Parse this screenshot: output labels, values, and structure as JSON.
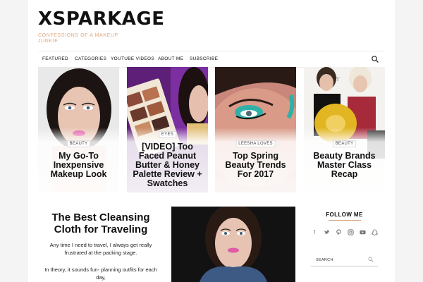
{
  "site": {
    "logo": "XSPARKAGE",
    "tagline": "CONFESSIONS OF A MAKEUP JUNKIE"
  },
  "nav": {
    "items": [
      "FEATURED",
      "CATEGORIES",
      "YOUTUBE VIDEOS",
      "ABOUT ME",
      "SUBSCRIBE"
    ],
    "search_icon": "search-icon"
  },
  "featured": [
    {
      "category": "BEAUTY",
      "title": "My Go-To Inexpensive Makeup Look"
    },
    {
      "category": "EYES",
      "title": "[VIDEO] Too Faced Peanut Butter & Honey Palette Review + Swatches"
    },
    {
      "category": "LEESHA LOVES",
      "title": "Top Spring Beauty Trends For 2017"
    },
    {
      "category": "BEAUTY",
      "title": "Beauty Brands Master Class Recap"
    }
  ],
  "post": {
    "title": "The Best Cleansing Cloth for Traveling",
    "paragraphs": [
      "Any time I need to travel, I always get really frustrated at the packing stage.",
      "In theory, it sounds fun- planning outfits for each day,"
    ]
  },
  "sidebar": {
    "follow_title": "FOLLOW ME",
    "social_icons": [
      "facebook-icon",
      "twitter-icon",
      "pinterest-icon",
      "instagram-icon",
      "youtube-icon",
      "snapchat-icon"
    ],
    "search_placeholder": "SEARCH"
  },
  "colors": {
    "accent": "#e0a980",
    "text": "#111111"
  }
}
